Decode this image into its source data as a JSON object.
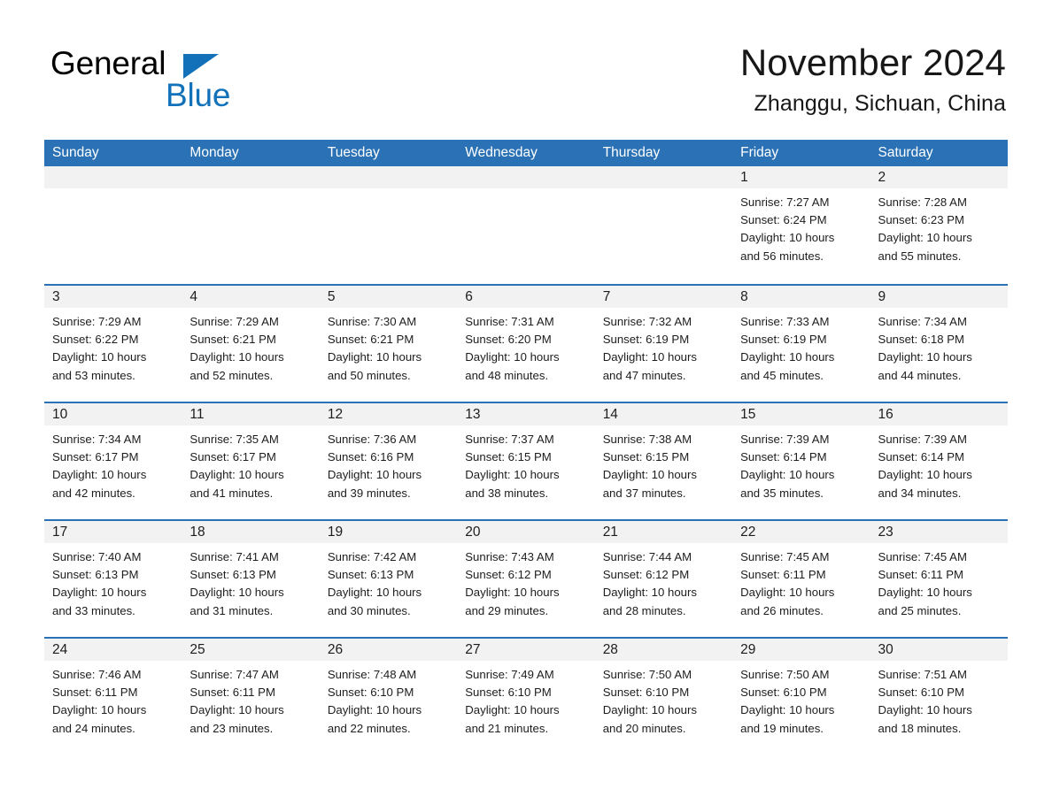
{
  "brand": {
    "name_part1": "General",
    "name_part2": "Blue",
    "accent_color": "#1271b8",
    "flag_icon": "triangle-flag-icon"
  },
  "header": {
    "month_title": "November 2024",
    "location": "Zhanggu, Sichuan, China"
  },
  "calendar": {
    "header_color": "#2a72b5",
    "weekdays": [
      "Sunday",
      "Monday",
      "Tuesday",
      "Wednesday",
      "Thursday",
      "Friday",
      "Saturday"
    ],
    "weeks": [
      [
        {
          "day": "",
          "empty": true
        },
        {
          "day": "",
          "empty": true
        },
        {
          "day": "",
          "empty": true
        },
        {
          "day": "",
          "empty": true
        },
        {
          "day": "",
          "empty": true
        },
        {
          "day": "1",
          "sunrise": "Sunrise: 7:27 AM",
          "sunset": "Sunset: 6:24 PM",
          "daylight_line1": "Daylight: 10 hours",
          "daylight_line2": "and 56 minutes."
        },
        {
          "day": "2",
          "sunrise": "Sunrise: 7:28 AM",
          "sunset": "Sunset: 6:23 PM",
          "daylight_line1": "Daylight: 10 hours",
          "daylight_line2": "and 55 minutes."
        }
      ],
      [
        {
          "day": "3",
          "sunrise": "Sunrise: 7:29 AM",
          "sunset": "Sunset: 6:22 PM",
          "daylight_line1": "Daylight: 10 hours",
          "daylight_line2": "and 53 minutes."
        },
        {
          "day": "4",
          "sunrise": "Sunrise: 7:29 AM",
          "sunset": "Sunset: 6:21 PM",
          "daylight_line1": "Daylight: 10 hours",
          "daylight_line2": "and 52 minutes."
        },
        {
          "day": "5",
          "sunrise": "Sunrise: 7:30 AM",
          "sunset": "Sunset: 6:21 PM",
          "daylight_line1": "Daylight: 10 hours",
          "daylight_line2": "and 50 minutes."
        },
        {
          "day": "6",
          "sunrise": "Sunrise: 7:31 AM",
          "sunset": "Sunset: 6:20 PM",
          "daylight_line1": "Daylight: 10 hours",
          "daylight_line2": "and 48 minutes."
        },
        {
          "day": "7",
          "sunrise": "Sunrise: 7:32 AM",
          "sunset": "Sunset: 6:19 PM",
          "daylight_line1": "Daylight: 10 hours",
          "daylight_line2": "and 47 minutes."
        },
        {
          "day": "8",
          "sunrise": "Sunrise: 7:33 AM",
          "sunset": "Sunset: 6:19 PM",
          "daylight_line1": "Daylight: 10 hours",
          "daylight_line2": "and 45 minutes."
        },
        {
          "day": "9",
          "sunrise": "Sunrise: 7:34 AM",
          "sunset": "Sunset: 6:18 PM",
          "daylight_line1": "Daylight: 10 hours",
          "daylight_line2": "and 44 minutes."
        }
      ],
      [
        {
          "day": "10",
          "sunrise": "Sunrise: 7:34 AM",
          "sunset": "Sunset: 6:17 PM",
          "daylight_line1": "Daylight: 10 hours",
          "daylight_line2": "and 42 minutes."
        },
        {
          "day": "11",
          "sunrise": "Sunrise: 7:35 AM",
          "sunset": "Sunset: 6:17 PM",
          "daylight_line1": "Daylight: 10 hours",
          "daylight_line2": "and 41 minutes."
        },
        {
          "day": "12",
          "sunrise": "Sunrise: 7:36 AM",
          "sunset": "Sunset: 6:16 PM",
          "daylight_line1": "Daylight: 10 hours",
          "daylight_line2": "and 39 minutes."
        },
        {
          "day": "13",
          "sunrise": "Sunrise: 7:37 AM",
          "sunset": "Sunset: 6:15 PM",
          "daylight_line1": "Daylight: 10 hours",
          "daylight_line2": "and 38 minutes."
        },
        {
          "day": "14",
          "sunrise": "Sunrise: 7:38 AM",
          "sunset": "Sunset: 6:15 PM",
          "daylight_line1": "Daylight: 10 hours",
          "daylight_line2": "and 37 minutes."
        },
        {
          "day": "15",
          "sunrise": "Sunrise: 7:39 AM",
          "sunset": "Sunset: 6:14 PM",
          "daylight_line1": "Daylight: 10 hours",
          "daylight_line2": "and 35 minutes."
        },
        {
          "day": "16",
          "sunrise": "Sunrise: 7:39 AM",
          "sunset": "Sunset: 6:14 PM",
          "daylight_line1": "Daylight: 10 hours",
          "daylight_line2": "and 34 minutes."
        }
      ],
      [
        {
          "day": "17",
          "sunrise": "Sunrise: 7:40 AM",
          "sunset": "Sunset: 6:13 PM",
          "daylight_line1": "Daylight: 10 hours",
          "daylight_line2": "and 33 minutes."
        },
        {
          "day": "18",
          "sunrise": "Sunrise: 7:41 AM",
          "sunset": "Sunset: 6:13 PM",
          "daylight_line1": "Daylight: 10 hours",
          "daylight_line2": "and 31 minutes."
        },
        {
          "day": "19",
          "sunrise": "Sunrise: 7:42 AM",
          "sunset": "Sunset: 6:13 PM",
          "daylight_line1": "Daylight: 10 hours",
          "daylight_line2": "and 30 minutes."
        },
        {
          "day": "20",
          "sunrise": "Sunrise: 7:43 AM",
          "sunset": "Sunset: 6:12 PM",
          "daylight_line1": "Daylight: 10 hours",
          "daylight_line2": "and 29 minutes."
        },
        {
          "day": "21",
          "sunrise": "Sunrise: 7:44 AM",
          "sunset": "Sunset: 6:12 PM",
          "daylight_line1": "Daylight: 10 hours",
          "daylight_line2": "and 28 minutes."
        },
        {
          "day": "22",
          "sunrise": "Sunrise: 7:45 AM",
          "sunset": "Sunset: 6:11 PM",
          "daylight_line1": "Daylight: 10 hours",
          "daylight_line2": "and 26 minutes."
        },
        {
          "day": "23",
          "sunrise": "Sunrise: 7:45 AM",
          "sunset": "Sunset: 6:11 PM",
          "daylight_line1": "Daylight: 10 hours",
          "daylight_line2": "and 25 minutes."
        }
      ],
      [
        {
          "day": "24",
          "sunrise": "Sunrise: 7:46 AM",
          "sunset": "Sunset: 6:11 PM",
          "daylight_line1": "Daylight: 10 hours",
          "daylight_line2": "and 24 minutes."
        },
        {
          "day": "25",
          "sunrise": "Sunrise: 7:47 AM",
          "sunset": "Sunset: 6:11 PM",
          "daylight_line1": "Daylight: 10 hours",
          "daylight_line2": "and 23 minutes."
        },
        {
          "day": "26",
          "sunrise": "Sunrise: 7:48 AM",
          "sunset": "Sunset: 6:10 PM",
          "daylight_line1": "Daylight: 10 hours",
          "daylight_line2": "and 22 minutes."
        },
        {
          "day": "27",
          "sunrise": "Sunrise: 7:49 AM",
          "sunset": "Sunset: 6:10 PM",
          "daylight_line1": "Daylight: 10 hours",
          "daylight_line2": "and 21 minutes."
        },
        {
          "day": "28",
          "sunrise": "Sunrise: 7:50 AM",
          "sunset": "Sunset: 6:10 PM",
          "daylight_line1": "Daylight: 10 hours",
          "daylight_line2": "and 20 minutes."
        },
        {
          "day": "29",
          "sunrise": "Sunrise: 7:50 AM",
          "sunset": "Sunset: 6:10 PM",
          "daylight_line1": "Daylight: 10 hours",
          "daylight_line2": "and 19 minutes."
        },
        {
          "day": "30",
          "sunrise": "Sunrise: 7:51 AM",
          "sunset": "Sunset: 6:10 PM",
          "daylight_line1": "Daylight: 10 hours",
          "daylight_line2": "and 18 minutes."
        }
      ]
    ]
  }
}
